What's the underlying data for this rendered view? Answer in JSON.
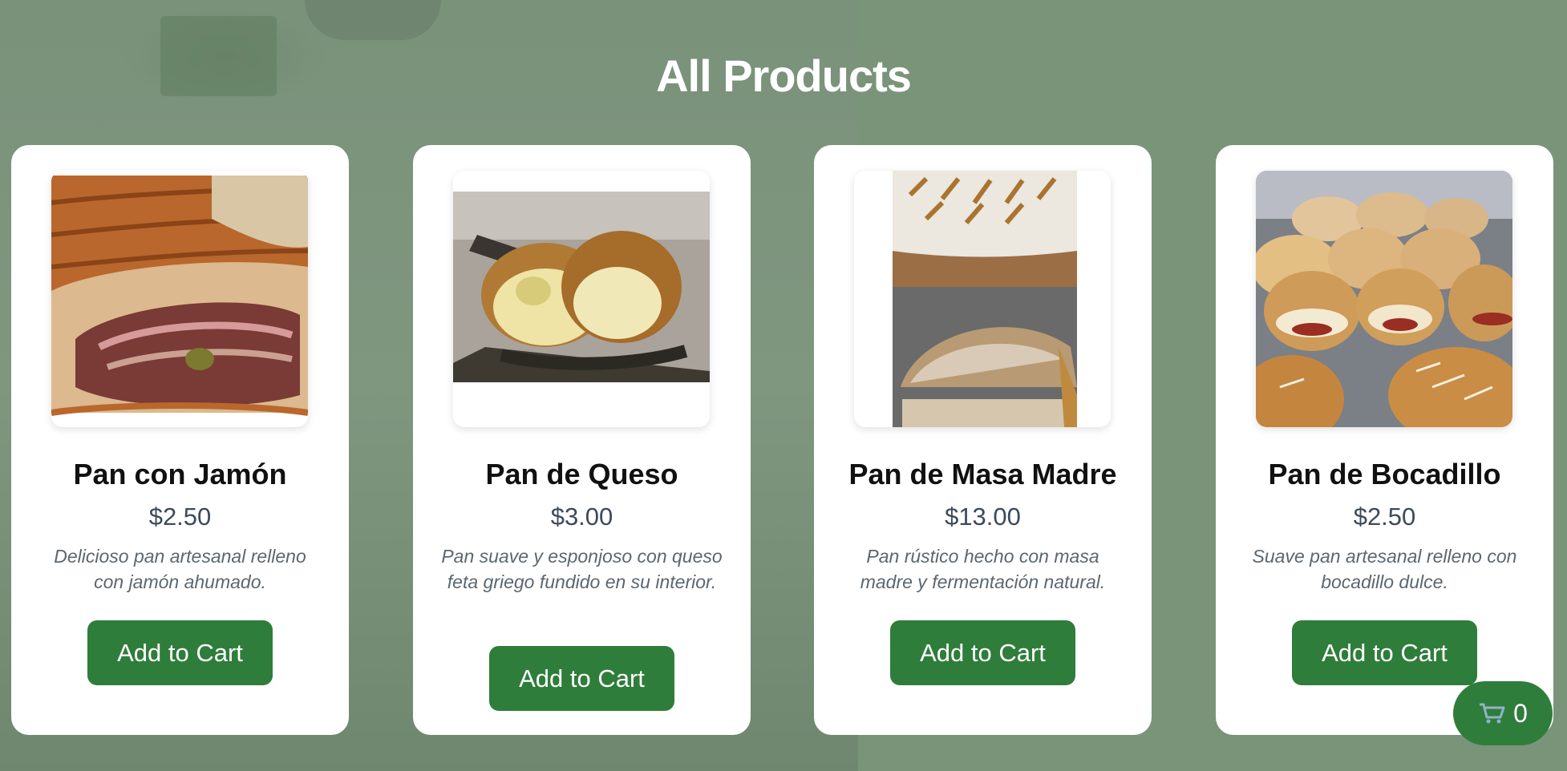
{
  "page": {
    "title": "All Products"
  },
  "products": [
    {
      "name": "Pan con Jamón",
      "price": "$2.50",
      "description": "Delicioso pan artesanal relleno con jamón ahumado.",
      "button": "Add to Cart",
      "image": "pan-con-jamon-photo"
    },
    {
      "name": "Pan de Queso",
      "price": "$3.00",
      "description": "Pan suave y esponjoso con queso feta griego fundido en su interior.",
      "button": "Add to Cart",
      "image": "pan-de-queso-photo"
    },
    {
      "name": "Pan de Masa Madre",
      "price": "$13.00",
      "description": "Pan rústico hecho con masa madre y fermentación natural.",
      "button": "Add to Cart",
      "image": "pan-de-masa-madre-photo"
    },
    {
      "name": "Pan de Bocadillo",
      "price": "$2.50",
      "description": "Suave pan artesanal relleno con bocadillo dulce.",
      "button": "Add to Cart",
      "image": "pan-de-bocadillo-photo"
    }
  ],
  "cart": {
    "icon": "cart-icon",
    "count": "0"
  },
  "colors": {
    "accent": "#2f7d3b",
    "background": "#7b937b",
    "card": "#ffffff"
  }
}
